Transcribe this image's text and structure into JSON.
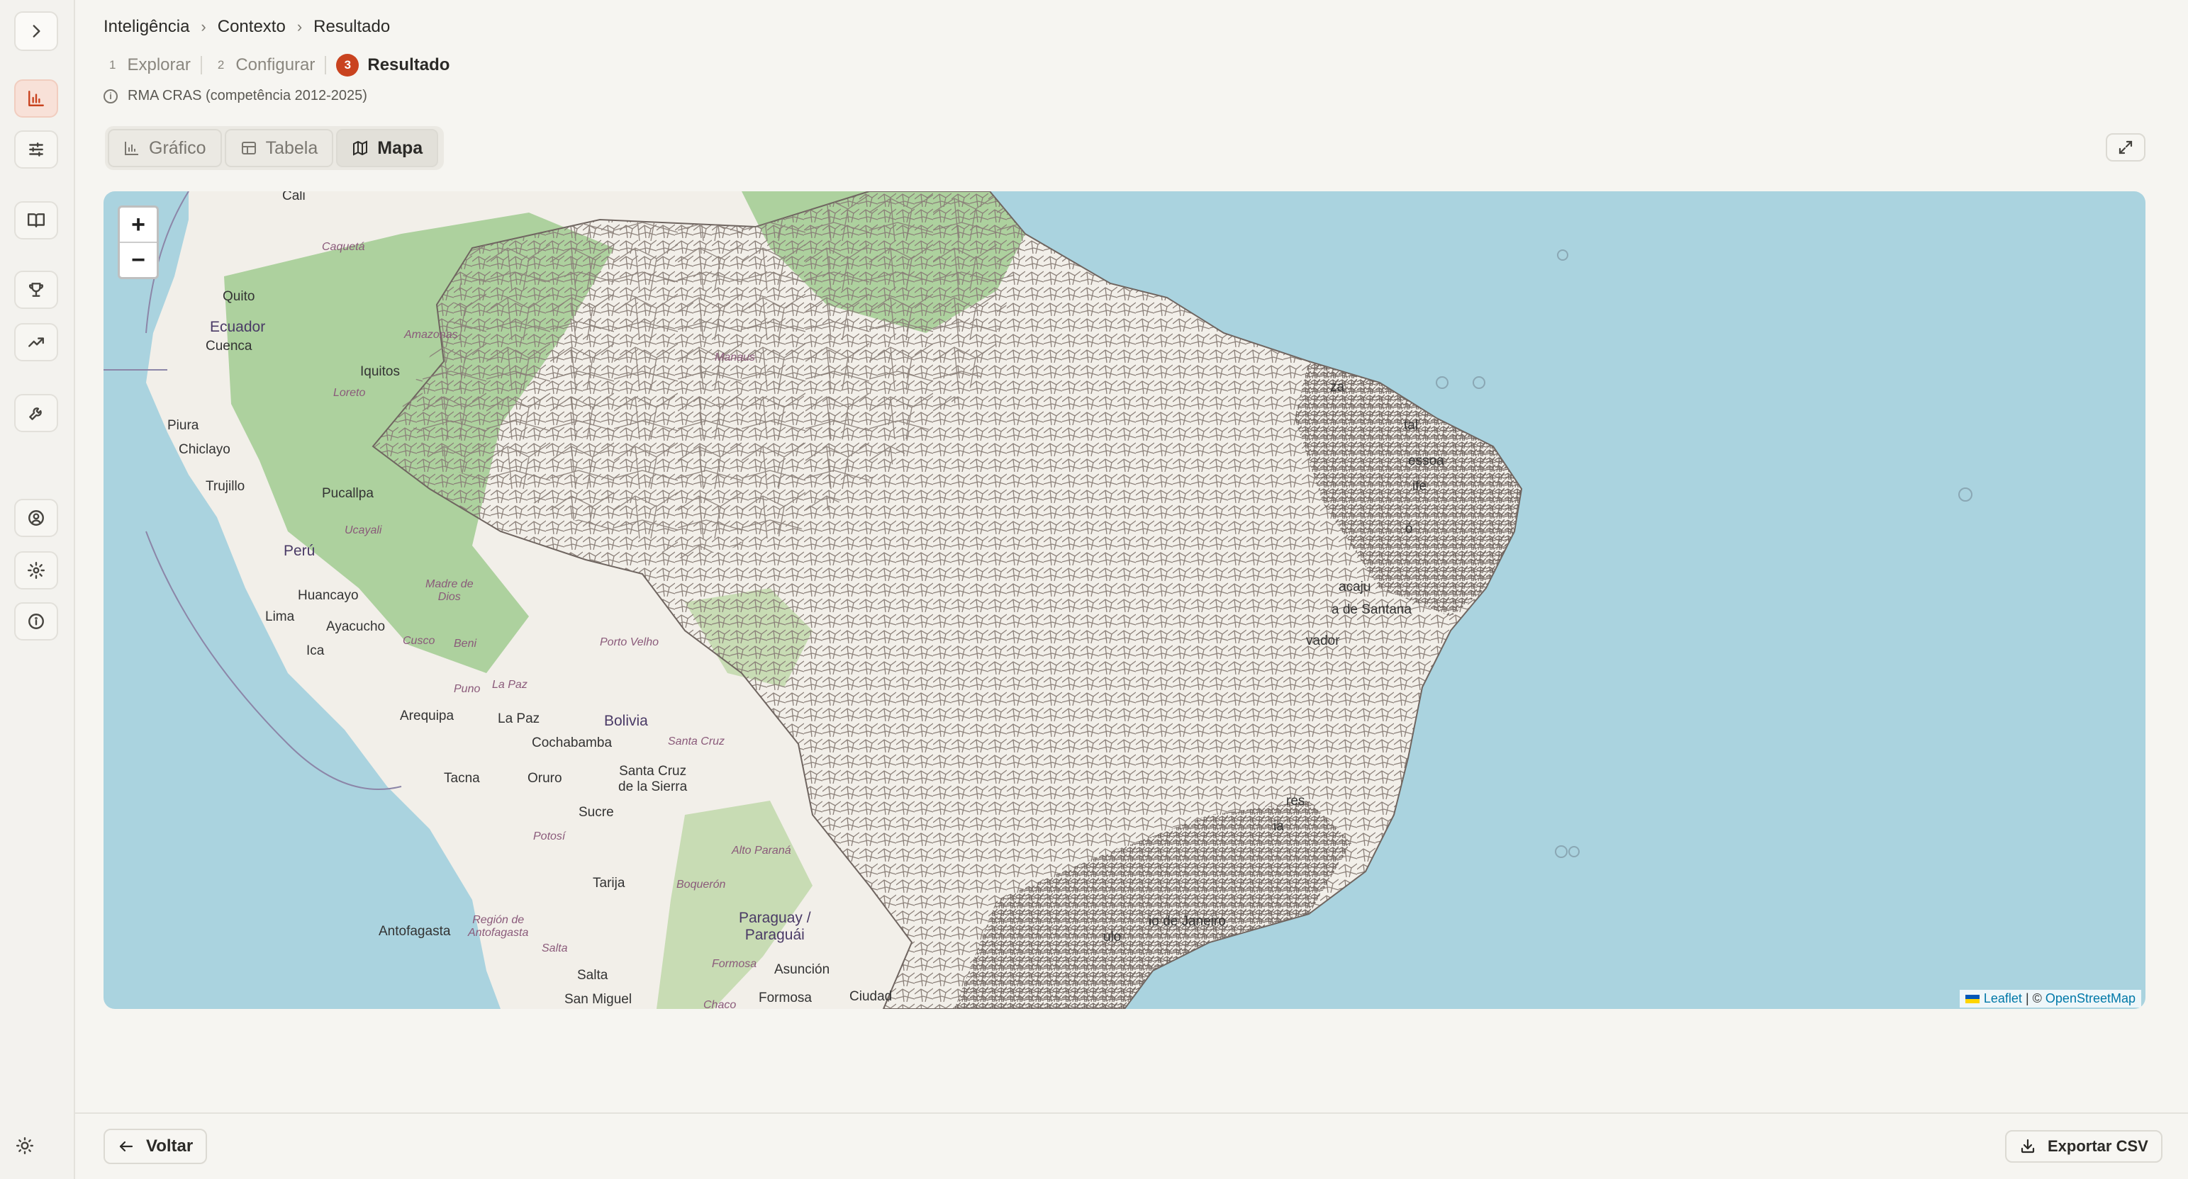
{
  "breadcrumb": [
    "Inteligência",
    "Contexto",
    "Resultado"
  ],
  "steps": [
    {
      "num": "1",
      "label": "Explorar"
    },
    {
      "num": "2",
      "label": "Configurar"
    },
    {
      "num": "3",
      "label": "Resultado"
    }
  ],
  "dataset_label": "RMA CRAS (competência 2012-2025)",
  "tabs": [
    {
      "label": "Gráfico",
      "icon": "bar-chart-icon"
    },
    {
      "label": "Tabela",
      "icon": "table-icon"
    },
    {
      "label": "Mapa",
      "icon": "map-icon"
    }
  ],
  "active_tab": "Mapa",
  "map": {
    "zoom_in": "+",
    "zoom_out": "−",
    "attribution": {
      "leaflet": "Leaflet",
      "separator": "| ©",
      "osm": "OpenStreetMap"
    },
    "labels": {
      "cali": "Cali",
      "quito": "Quito",
      "ecuador": "Ecuador",
      "cuenca": "Cuenca",
      "iquitos": "Iquitos",
      "piura": "Piura",
      "chiclayo": "Chiclayo",
      "trujillo": "Trujillo",
      "pucallpa": "Pucallpa",
      "peru": "Perú",
      "huancayo": "Huancayo",
      "lima": "Lima",
      "ayacucho": "Ayacucho",
      "ica": "Ica",
      "cusco": "Cusco",
      "arequipa": "Arequipa",
      "puno": "Puno",
      "lapaz": "La Paz",
      "bolivia": "Bolivia",
      "cochabamba": "Cochabamba",
      "tacna": "Tacna",
      "oruro": "Oruro",
      "santacruz": "Santa Cruz\nde la Sierra",
      "sucre": "Sucre",
      "tarija": "Tarija",
      "antofagasta": "Antofagasta",
      "salta": "Salta",
      "paraguay": "Paraguay /\nParaguái",
      "asuncion": "Asunción",
      "formosa": "Formosa",
      "sanmiguel": "San Miguel",
      "ciudad": "Ciudad",
      "natal": "tal",
      "joaopessoa": "essoa",
      "recife": "ife",
      "maceio": "ó",
      "aracaju": "acaju",
      "feira": "a de Santana",
      "salvador": "vador",
      "vitoria": "res",
      "campos": "ia",
      "rio": "io de Janeiro",
      "sp": "ulo",
      "fortaleza": "za",
      "beni": "Beni",
      "santacruz_region": "Santa Cruz",
      "potosi": "Potosí",
      "altoparana": "Alto Paraná",
      "boqueron": "Boquerón",
      "antofagasta_region": "Región de\nAntofagasta",
      "formosa_region": "Formosa",
      "salta_region": "Salta",
      "chaco": "Chaco",
      "amazonas": "Amazonas",
      "caqueta": "Caquetá",
      "loreto": "Loreto",
      "ucayali": "Ucayali",
      "madrededios": "Madre de\nDios",
      "cusco_region": "Cusco",
      "puno_region": "Puno",
      "lapaz_region": "La Paz",
      "portovelho": "Porto Velho",
      "manaus": "Manaus"
    }
  },
  "footer": {
    "back": "Voltar",
    "export": "Exportar CSV"
  },
  "sidebar": {
    "items": [
      "expand-icon",
      "chart-icon",
      "sliders-icon",
      "book-icon",
      "trophy-icon",
      "trending-icon",
      "wrench-icon",
      "user-circle-icon",
      "settings-icon",
      "info-icon"
    ],
    "active": "chart-icon"
  },
  "colors": {
    "accent": "#c9431f",
    "ocean": "#aad3df",
    "land": "#f2efe9",
    "forest": "#add19e"
  }
}
